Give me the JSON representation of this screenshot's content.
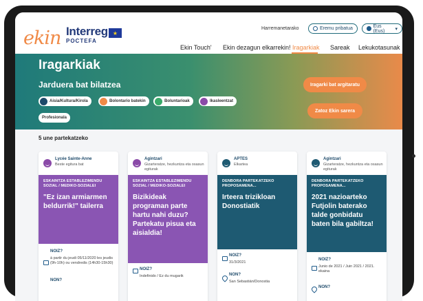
{
  "header": {
    "logo_ekin": "ekin",
    "logo_interreg": "Interreg",
    "logo_poctefa": "POCTEFA",
    "top_links": {
      "contact": "Harremanetarako"
    },
    "private_area": "Eremu pribatua",
    "language": "Eus (Eus)",
    "nav": [
      "Ekin Touch'",
      "Ekin dezagun elkarrekin!",
      "Iragarkiak",
      "Sareak",
      "Lekukotasunak"
    ],
    "active_nav": "Iragarkiak"
  },
  "hero": {
    "title": "Iragarkiak",
    "subtitle": "Jarduera bat bilatzea",
    "filters": [
      {
        "label": "Aisia/Kultura/Kirola",
        "color": "#1e4a6a"
      },
      {
        "label": "Bolontario batekin",
        "color": "#f08a47"
      },
      {
        "label": "Boluntarioak",
        "color": "#3aaa6a"
      },
      {
        "label": "Ikasleentzat",
        "color": "#8a4aa8"
      },
      {
        "label": "Profesionala",
        "color": "#ffffff"
      }
    ],
    "publish_button": "Iragarki bat argitaratu",
    "join_button": "Zatoz Ekin sarera"
  },
  "results": {
    "count_text": "5 une partekatzeko"
  },
  "cards": [
    {
      "org": "Lycée Sainte-Anne",
      "org_sub": "Beste egitura bat",
      "avatar_color": "#8a4aa8",
      "body_color": "#8a55b3",
      "category": "ESKAINTZA ESTABLEZIMENDU SOZIAL / MEDIKO-SOZIALEI",
      "title": "\"Ez izan armiarmen beldurrik!\" tailerra",
      "when_label": "NOIZ?",
      "when_value": "à partir du jeudi 05/11/2020 les jeudis (9h-10h) ou vendredis (14h30-15h30)",
      "where_label": "NON?"
    },
    {
      "org": "Agintzari",
      "org_sub": "Gizarteratze, hezkuntza eta osasun egiturak",
      "avatar_color": "#8a4aa8",
      "body_color": "#8a55b3",
      "category": "ESKAINTZA ESTABLEZIMENDU SOZIAL / MEDIKO-SOZIALEI",
      "title": "Bizikideak programan parte hartu nahi duzu? Partekatu pisua eta aisialdia!",
      "when_label": "NOIZ?",
      "when_value": "Indefinido / Ez du mugarik",
      "where_label": ""
    },
    {
      "org": "APTES",
      "org_sub": "Elkartea",
      "avatar_color": "#1e5a72",
      "body_color": "#1e5a72",
      "category": "DENBORA PARTEKATZEKO PROPOSAMENA...",
      "title": "Irteera trizikloan Donostiatik",
      "when_label": "NOIZ?",
      "when_value": "31/3/2021",
      "where_label": "NON?",
      "where_value": "San Sebastián/Donostia"
    },
    {
      "org": "Agintzari",
      "org_sub": "Gizarteratze, hezkuntza eta osasun egiturak",
      "avatar_color": "#1e5a72",
      "body_color": "#1e5a72",
      "category": "DENBORA PARTEKATZEKO PROPOSAMENA...",
      "title": "2021 nazioarteko Futjolin baterako talde gonbidatu baten bila gabiltza!",
      "when_label": "NOIZ?",
      "when_value": "Junio de 2021 / Juin 2021 / 2021. ekaina",
      "where_label": "NON?"
    }
  ]
}
